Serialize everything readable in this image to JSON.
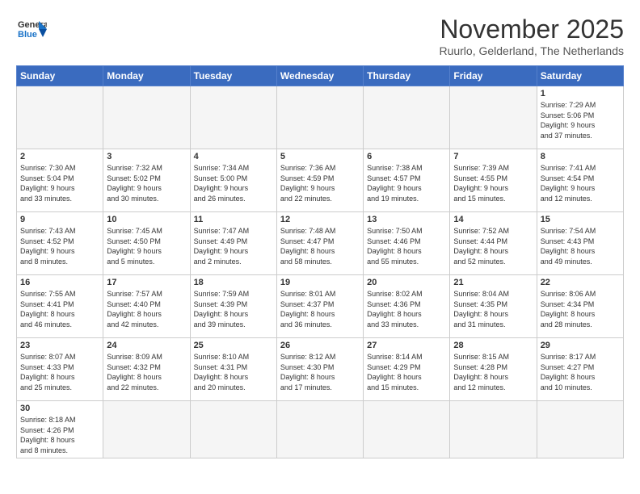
{
  "header": {
    "logo_general": "General",
    "logo_blue": "Blue",
    "month_title": "November 2025",
    "subtitle": "Ruurlo, Gelderland, The Netherlands"
  },
  "days_of_week": [
    "Sunday",
    "Monday",
    "Tuesday",
    "Wednesday",
    "Thursday",
    "Friday",
    "Saturday"
  ],
  "weeks": [
    [
      {
        "day": "",
        "empty": true
      },
      {
        "day": "",
        "empty": true
      },
      {
        "day": "",
        "empty": true
      },
      {
        "day": "",
        "empty": true
      },
      {
        "day": "",
        "empty": true
      },
      {
        "day": "",
        "empty": true
      },
      {
        "day": "1",
        "info": "Sunrise: 7:29 AM\nSunset: 5:06 PM\nDaylight: 9 hours\nand 37 minutes."
      }
    ],
    [
      {
        "day": "2",
        "info": "Sunrise: 7:30 AM\nSunset: 5:04 PM\nDaylight: 9 hours\nand 33 minutes."
      },
      {
        "day": "3",
        "info": "Sunrise: 7:32 AM\nSunset: 5:02 PM\nDaylight: 9 hours\nand 30 minutes."
      },
      {
        "day": "4",
        "info": "Sunrise: 7:34 AM\nSunset: 5:00 PM\nDaylight: 9 hours\nand 26 minutes."
      },
      {
        "day": "5",
        "info": "Sunrise: 7:36 AM\nSunset: 4:59 PM\nDaylight: 9 hours\nand 22 minutes."
      },
      {
        "day": "6",
        "info": "Sunrise: 7:38 AM\nSunset: 4:57 PM\nDaylight: 9 hours\nand 19 minutes."
      },
      {
        "day": "7",
        "info": "Sunrise: 7:39 AM\nSunset: 4:55 PM\nDaylight: 9 hours\nand 15 minutes."
      },
      {
        "day": "8",
        "info": "Sunrise: 7:41 AM\nSunset: 4:54 PM\nDaylight: 9 hours\nand 12 minutes."
      }
    ],
    [
      {
        "day": "9",
        "info": "Sunrise: 7:43 AM\nSunset: 4:52 PM\nDaylight: 9 hours\nand 8 minutes."
      },
      {
        "day": "10",
        "info": "Sunrise: 7:45 AM\nSunset: 4:50 PM\nDaylight: 9 hours\nand 5 minutes."
      },
      {
        "day": "11",
        "info": "Sunrise: 7:47 AM\nSunset: 4:49 PM\nDaylight: 9 hours\nand 2 minutes."
      },
      {
        "day": "12",
        "info": "Sunrise: 7:48 AM\nSunset: 4:47 PM\nDaylight: 8 hours\nand 58 minutes."
      },
      {
        "day": "13",
        "info": "Sunrise: 7:50 AM\nSunset: 4:46 PM\nDaylight: 8 hours\nand 55 minutes."
      },
      {
        "day": "14",
        "info": "Sunrise: 7:52 AM\nSunset: 4:44 PM\nDaylight: 8 hours\nand 52 minutes."
      },
      {
        "day": "15",
        "info": "Sunrise: 7:54 AM\nSunset: 4:43 PM\nDaylight: 8 hours\nand 49 minutes."
      }
    ],
    [
      {
        "day": "16",
        "info": "Sunrise: 7:55 AM\nSunset: 4:41 PM\nDaylight: 8 hours\nand 46 minutes."
      },
      {
        "day": "17",
        "info": "Sunrise: 7:57 AM\nSunset: 4:40 PM\nDaylight: 8 hours\nand 42 minutes."
      },
      {
        "day": "18",
        "info": "Sunrise: 7:59 AM\nSunset: 4:39 PM\nDaylight: 8 hours\nand 39 minutes."
      },
      {
        "day": "19",
        "info": "Sunrise: 8:01 AM\nSunset: 4:37 PM\nDaylight: 8 hours\nand 36 minutes."
      },
      {
        "day": "20",
        "info": "Sunrise: 8:02 AM\nSunset: 4:36 PM\nDaylight: 8 hours\nand 33 minutes."
      },
      {
        "day": "21",
        "info": "Sunrise: 8:04 AM\nSunset: 4:35 PM\nDaylight: 8 hours\nand 31 minutes."
      },
      {
        "day": "22",
        "info": "Sunrise: 8:06 AM\nSunset: 4:34 PM\nDaylight: 8 hours\nand 28 minutes."
      }
    ],
    [
      {
        "day": "23",
        "info": "Sunrise: 8:07 AM\nSunset: 4:33 PM\nDaylight: 8 hours\nand 25 minutes."
      },
      {
        "day": "24",
        "info": "Sunrise: 8:09 AM\nSunset: 4:32 PM\nDaylight: 8 hours\nand 22 minutes."
      },
      {
        "day": "25",
        "info": "Sunrise: 8:10 AM\nSunset: 4:31 PM\nDaylight: 8 hours\nand 20 minutes."
      },
      {
        "day": "26",
        "info": "Sunrise: 8:12 AM\nSunset: 4:30 PM\nDaylight: 8 hours\nand 17 minutes."
      },
      {
        "day": "27",
        "info": "Sunrise: 8:14 AM\nSunset: 4:29 PM\nDaylight: 8 hours\nand 15 minutes."
      },
      {
        "day": "28",
        "info": "Sunrise: 8:15 AM\nSunset: 4:28 PM\nDaylight: 8 hours\nand 12 minutes."
      },
      {
        "day": "29",
        "info": "Sunrise: 8:17 AM\nSunset: 4:27 PM\nDaylight: 8 hours\nand 10 minutes."
      }
    ],
    [
      {
        "day": "30",
        "info": "Sunrise: 8:18 AM\nSunset: 4:26 PM\nDaylight: 8 hours\nand 8 minutes.",
        "last": true
      },
      {
        "day": "",
        "empty": true,
        "last": true
      },
      {
        "day": "",
        "empty": true,
        "last": true
      },
      {
        "day": "",
        "empty": true,
        "last": true
      },
      {
        "day": "",
        "empty": true,
        "last": true
      },
      {
        "day": "",
        "empty": true,
        "last": true
      },
      {
        "day": "",
        "empty": true,
        "last": true
      }
    ]
  ]
}
